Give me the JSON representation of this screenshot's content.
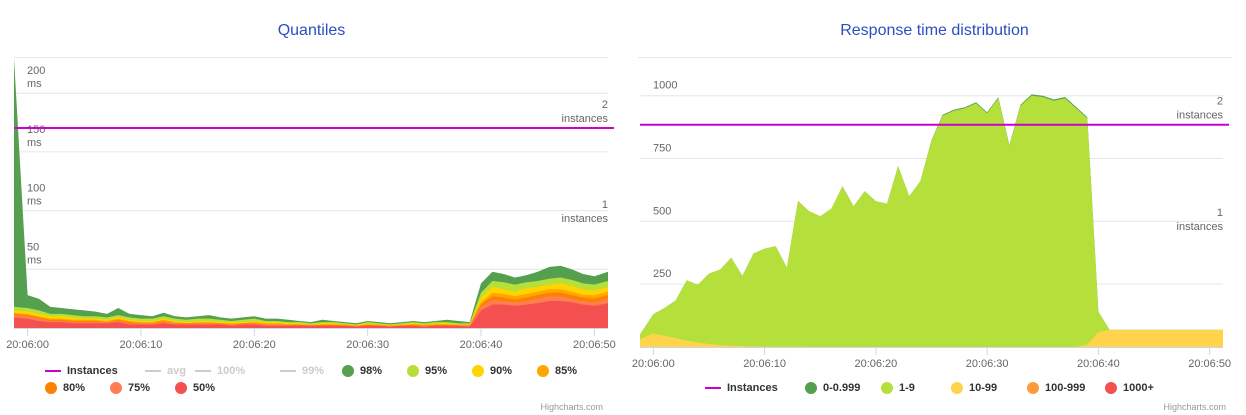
{
  "charts_ui": {
    "quantiles": {
      "title": "Quantiles",
      "legend": [
        {
          "label": "Instances",
          "color": "#cc00cc",
          "kind": "line",
          "enabled": true
        },
        {
          "label": "avg",
          "color": "#cccccc",
          "kind": "line",
          "enabled": false
        },
        {
          "label": "100%",
          "color": "#cccccc",
          "kind": "line",
          "enabled": false
        },
        {
          "label": "99%",
          "color": "#cccccc",
          "kind": "line",
          "enabled": false
        },
        {
          "label": "98%",
          "color": "#55a04f",
          "kind": "dot",
          "enabled": true
        },
        {
          "label": "95%",
          "color": "#b5e03c",
          "kind": "dot",
          "enabled": true
        },
        {
          "label": "90%",
          "color": "#ffd400",
          "kind": "dot",
          "enabled": true
        },
        {
          "label": "85%",
          "color": "#ffa600",
          "kind": "dot",
          "enabled": true
        },
        {
          "label": "80%",
          "color": "#ff7f00",
          "kind": "dot",
          "enabled": true
        },
        {
          "label": "75%",
          "color": "#ff7f50",
          "kind": "dot",
          "enabled": true
        },
        {
          "label": "50%",
          "color": "#f45050",
          "kind": "dot",
          "enabled": true
        }
      ],
      "credits": "Highcharts.com"
    },
    "distribution": {
      "title": "Response time distribution",
      "legend": [
        {
          "label": "Instances",
          "color": "#cc00cc",
          "kind": "line",
          "enabled": true
        },
        {
          "label": "0-0.999",
          "color": "#55a04f",
          "kind": "dot",
          "enabled": true
        },
        {
          "label": "1-9",
          "color": "#b5e03c",
          "kind": "dot",
          "enabled": true
        },
        {
          "label": "10-99",
          "color": "#ffd44c",
          "kind": "dot",
          "enabled": true
        },
        {
          "label": "100-999",
          "color": "#ff9a3c",
          "kind": "dot",
          "enabled": true
        },
        {
          "label": "1000+",
          "color": "#f45050",
          "kind": "dot",
          "enabled": true
        }
      ],
      "credits": "Highcharts.com"
    }
  },
  "chart_data": [
    {
      "type": "area",
      "title": "Quantiles",
      "x_tick_labels": [
        "20:06:00",
        "20:06:10",
        "20:06:20",
        "20:06:30",
        "20:06:40",
        "20:06:50"
      ],
      "x_range_seconds": [
        -1.2,
        51.2
      ],
      "y_tick_values": [
        50,
        100,
        150,
        200
      ],
      "y_unit": "ms",
      "ylim": [
        0,
        230
      ],
      "instances": {
        "value": 2,
        "tick_labels": [
          {
            "value": 1,
            "text": "1",
            "unit": "instances"
          },
          {
            "value": 2,
            "text": "2",
            "unit": "instances"
          }
        ],
        "range": [
          0,
          2.7
        ]
      },
      "x_seconds": [
        -1.2,
        0,
        1,
        2,
        3,
        4,
        5,
        6,
        7,
        8,
        9,
        10,
        11,
        12,
        13,
        14,
        15,
        16,
        17,
        18,
        19,
        20,
        21,
        22,
        23,
        24,
        25,
        26,
        27,
        28,
        29,
        30,
        31,
        32,
        33,
        34,
        35,
        36,
        37,
        38,
        39,
        40,
        41,
        42,
        43,
        44,
        45,
        46,
        47,
        48,
        49,
        50,
        51.2
      ],
      "series": [
        {
          "name": "98%",
          "color": "#55a04f",
          "values": [
            230,
            28,
            25,
            18,
            17,
            16,
            15,
            14,
            12,
            17,
            12,
            11,
            10,
            13,
            10,
            9,
            10,
            11,
            9,
            8,
            9,
            10,
            8,
            8,
            7,
            6,
            5,
            7,
            6,
            5,
            4,
            6,
            5,
            4,
            5,
            6,
            5,
            6,
            7,
            6,
            5,
            38,
            48,
            46,
            43,
            45,
            48,
            52,
            53,
            50,
            46,
            44,
            48
          ]
        },
        {
          "name": "95%",
          "color": "#b5e03c",
          "values": [
            18,
            17,
            15,
            12,
            12,
            11,
            10,
            10,
            9,
            11,
            9,
            8,
            8,
            10,
            8,
            7,
            8,
            8,
            7,
            6,
            7,
            8,
            6,
            6,
            5,
            5,
            4,
            5,
            5,
            4,
            3,
            5,
            4,
            3,
            4,
            5,
            4,
            5,
            5,
            4,
            4,
            30,
            40,
            39,
            37,
            39,
            40,
            42,
            43,
            41,
            38,
            37,
            40
          ]
        },
        {
          "name": "90%",
          "color": "#ffd400",
          "values": [
            15,
            14,
            12,
            10,
            10,
            9,
            8,
            8,
            7,
            9,
            7,
            6,
            6,
            8,
            6,
            5,
            6,
            6,
            5,
            5,
            5,
            6,
            5,
            5,
            4,
            4,
            3,
            4,
            4,
            3,
            3,
            4,
            3,
            3,
            3,
            4,
            3,
            4,
            4,
            3,
            3,
            26,
            35,
            33,
            31,
            34,
            35,
            37,
            38,
            36,
            33,
            32,
            35
          ]
        },
        {
          "name": "85%",
          "color": "#ffa600",
          "values": [
            13,
            12,
            10,
            8,
            8,
            7,
            7,
            7,
            6,
            8,
            6,
            5,
            5,
            7,
            5,
            4,
            5,
            5,
            4,
            4,
            4,
            5,
            4,
            4,
            3,
            3,
            3,
            3,
            3,
            3,
            2,
            3,
            3,
            2,
            3,
            3,
            3,
            3,
            3,
            3,
            3,
            22,
            30,
            29,
            27,
            29,
            31,
            33,
            33,
            31,
            28,
            28,
            31
          ]
        },
        {
          "name": "80%",
          "color": "#ff7f00",
          "values": [
            12,
            11,
            9,
            7,
            7,
            6,
            6,
            6,
            5,
            7,
            5,
            4,
            4,
            6,
            4,
            4,
            4,
            4,
            4,
            3,
            4,
            4,
            3,
            3,
            3,
            3,
            2,
            3,
            3,
            2,
            2,
            3,
            2,
            2,
            2,
            3,
            2,
            3,
            3,
            2,
            2,
            20,
            27,
            26,
            24,
            26,
            28,
            30,
            30,
            28,
            26,
            25,
            28
          ]
        },
        {
          "name": "75%",
          "color": "#ff7f50",
          "values": [
            11,
            10,
            8,
            6,
            6,
            5,
            5,
            5,
            5,
            6,
            4,
            4,
            4,
            5,
            4,
            3,
            4,
            4,
            3,
            3,
            3,
            4,
            3,
            3,
            2,
            2,
            2,
            2,
            2,
            2,
            2,
            2,
            2,
            2,
            2,
            2,
            2,
            2,
            2,
            2,
            2,
            18,
            24,
            23,
            22,
            23,
            25,
            27,
            27,
            25,
            23,
            22,
            25
          ]
        },
        {
          "name": "50%",
          "color": "#f45050",
          "values": [
            9,
            8,
            6,
            5,
            5,
            4,
            4,
            4,
            4,
            5,
            3,
            3,
            3,
            4,
            3,
            3,
            3,
            3,
            3,
            2,
            3,
            3,
            2,
            2,
            2,
            2,
            2,
            2,
            2,
            2,
            1,
            2,
            2,
            1,
            2,
            2,
            1,
            2,
            2,
            2,
            1,
            15,
            20,
            20,
            19,
            20,
            21,
            23,
            23,
            22,
            20,
            19,
            21
          ]
        }
      ]
    },
    {
      "type": "area",
      "title": "Response time distribution",
      "x_tick_labels": [
        "20:06:00",
        "20:06:10",
        "20:06:20",
        "20:06:30",
        "20:06:40",
        "20:06:50"
      ],
      "x_range_seconds": [
        -1.2,
        51.2
      ],
      "y_tick_values": [
        250,
        500,
        750,
        1000
      ],
      "ylim": [
        0,
        1150
      ],
      "instances": {
        "value": 2,
        "tick_labels": [
          {
            "value": 1,
            "text": "1",
            "unit": "instances"
          },
          {
            "value": 2,
            "text": "2",
            "unit": "instances"
          }
        ],
        "range": [
          0,
          2.6
        ]
      },
      "x_seconds": [
        -1.2,
        0,
        1,
        2,
        3,
        4,
        5,
        6,
        7,
        8,
        9,
        10,
        11,
        12,
        13,
        14,
        15,
        16,
        17,
        18,
        19,
        20,
        21,
        22,
        23,
        24,
        25,
        26,
        27,
        28,
        29,
        30,
        31,
        32,
        33,
        34,
        35,
        36,
        37,
        38,
        39,
        40,
        41,
        42,
        43,
        44,
        45,
        46,
        47,
        48,
        49,
        50,
        51.2
      ],
      "series": [
        {
          "name": "10-99",
          "color": "#ffd44c",
          "values": [
            30,
            55,
            45,
            35,
            25,
            18,
            12,
            8,
            5,
            3,
            2,
            1,
            1,
            1,
            1,
            0,
            0,
            0,
            0,
            0,
            0,
            0,
            0,
            0,
            0,
            0,
            0,
            0,
            0,
            0,
            0,
            0,
            0,
            0,
            0,
            0,
            0,
            0,
            0,
            0,
            10,
            60,
            68,
            68,
            68,
            68,
            68,
            68,
            68,
            68,
            68,
            68,
            68
          ]
        },
        {
          "name": "1-9",
          "color": "#b5e03c",
          "values": [
            20,
            75,
            110,
            150,
            240,
            230,
            280,
            300,
            350,
            280,
            370,
            390,
            400,
            315,
            580,
            540,
            520,
            550,
            640,
            560,
            620,
            580,
            570,
            720,
            600,
            660,
            820,
            920,
            940,
            950,
            970,
            930,
            990,
            800,
            960,
            1000,
            995,
            980,
            990,
            950,
            900,
            80,
            0,
            0,
            0,
            0,
            0,
            0,
            0,
            0,
            0,
            0,
            0
          ]
        },
        {
          "name": "0-0.999",
          "color": "#55a04f",
          "values": [
            0,
            0,
            0,
            0,
            0,
            0,
            0,
            0,
            0,
            0,
            0,
            0,
            0,
            0,
            0,
            0,
            0,
            0,
            0,
            0,
            0,
            0,
            0,
            0,
            0,
            0,
            3,
            4,
            4,
            4,
            4,
            4,
            4,
            3,
            4,
            5,
            5,
            5,
            5,
            5,
            5,
            0,
            0,
            0,
            0,
            0,
            0,
            0,
            0,
            0,
            0,
            0,
            0
          ]
        }
      ]
    }
  ]
}
